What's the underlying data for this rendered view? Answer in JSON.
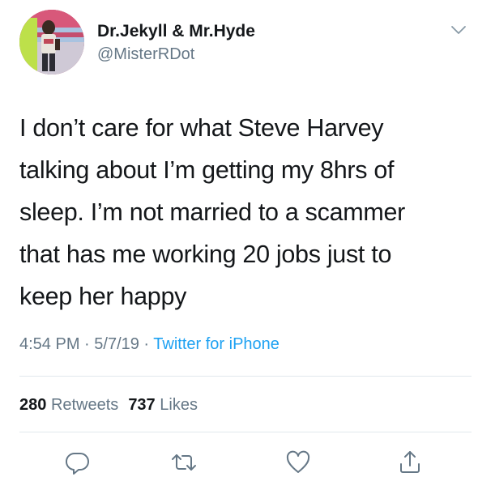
{
  "user": {
    "display_name": "Dr.Jekyll & Mr.Hyde",
    "handle": "@MisterRDot"
  },
  "tweet": {
    "lines": [
      "I don’t care for what Steve Harvey",
      "talking about I’m getting my 8hrs of",
      "sleep. I’m not married to a scammer",
      "that has me working 20 jobs just to",
      "keep her happy"
    ]
  },
  "meta": {
    "time": "4:54 PM",
    "date": "5/7/19",
    "separator": " · ",
    "source": "Twitter for iPhone"
  },
  "stats": {
    "retweets_count": "280",
    "retweets_label": "Retweets",
    "likes_count": "737",
    "likes_label": "Likes"
  },
  "icons": {
    "chevron": "chevron-down-icon",
    "reply": "reply-icon",
    "retweet": "retweet-icon",
    "like": "heart-icon",
    "share": "share-icon"
  },
  "colors": {
    "text": "#14171a",
    "secondary": "#657786",
    "link": "#1da1f2",
    "divider": "#e1e8ed",
    "icon": "#657786"
  }
}
